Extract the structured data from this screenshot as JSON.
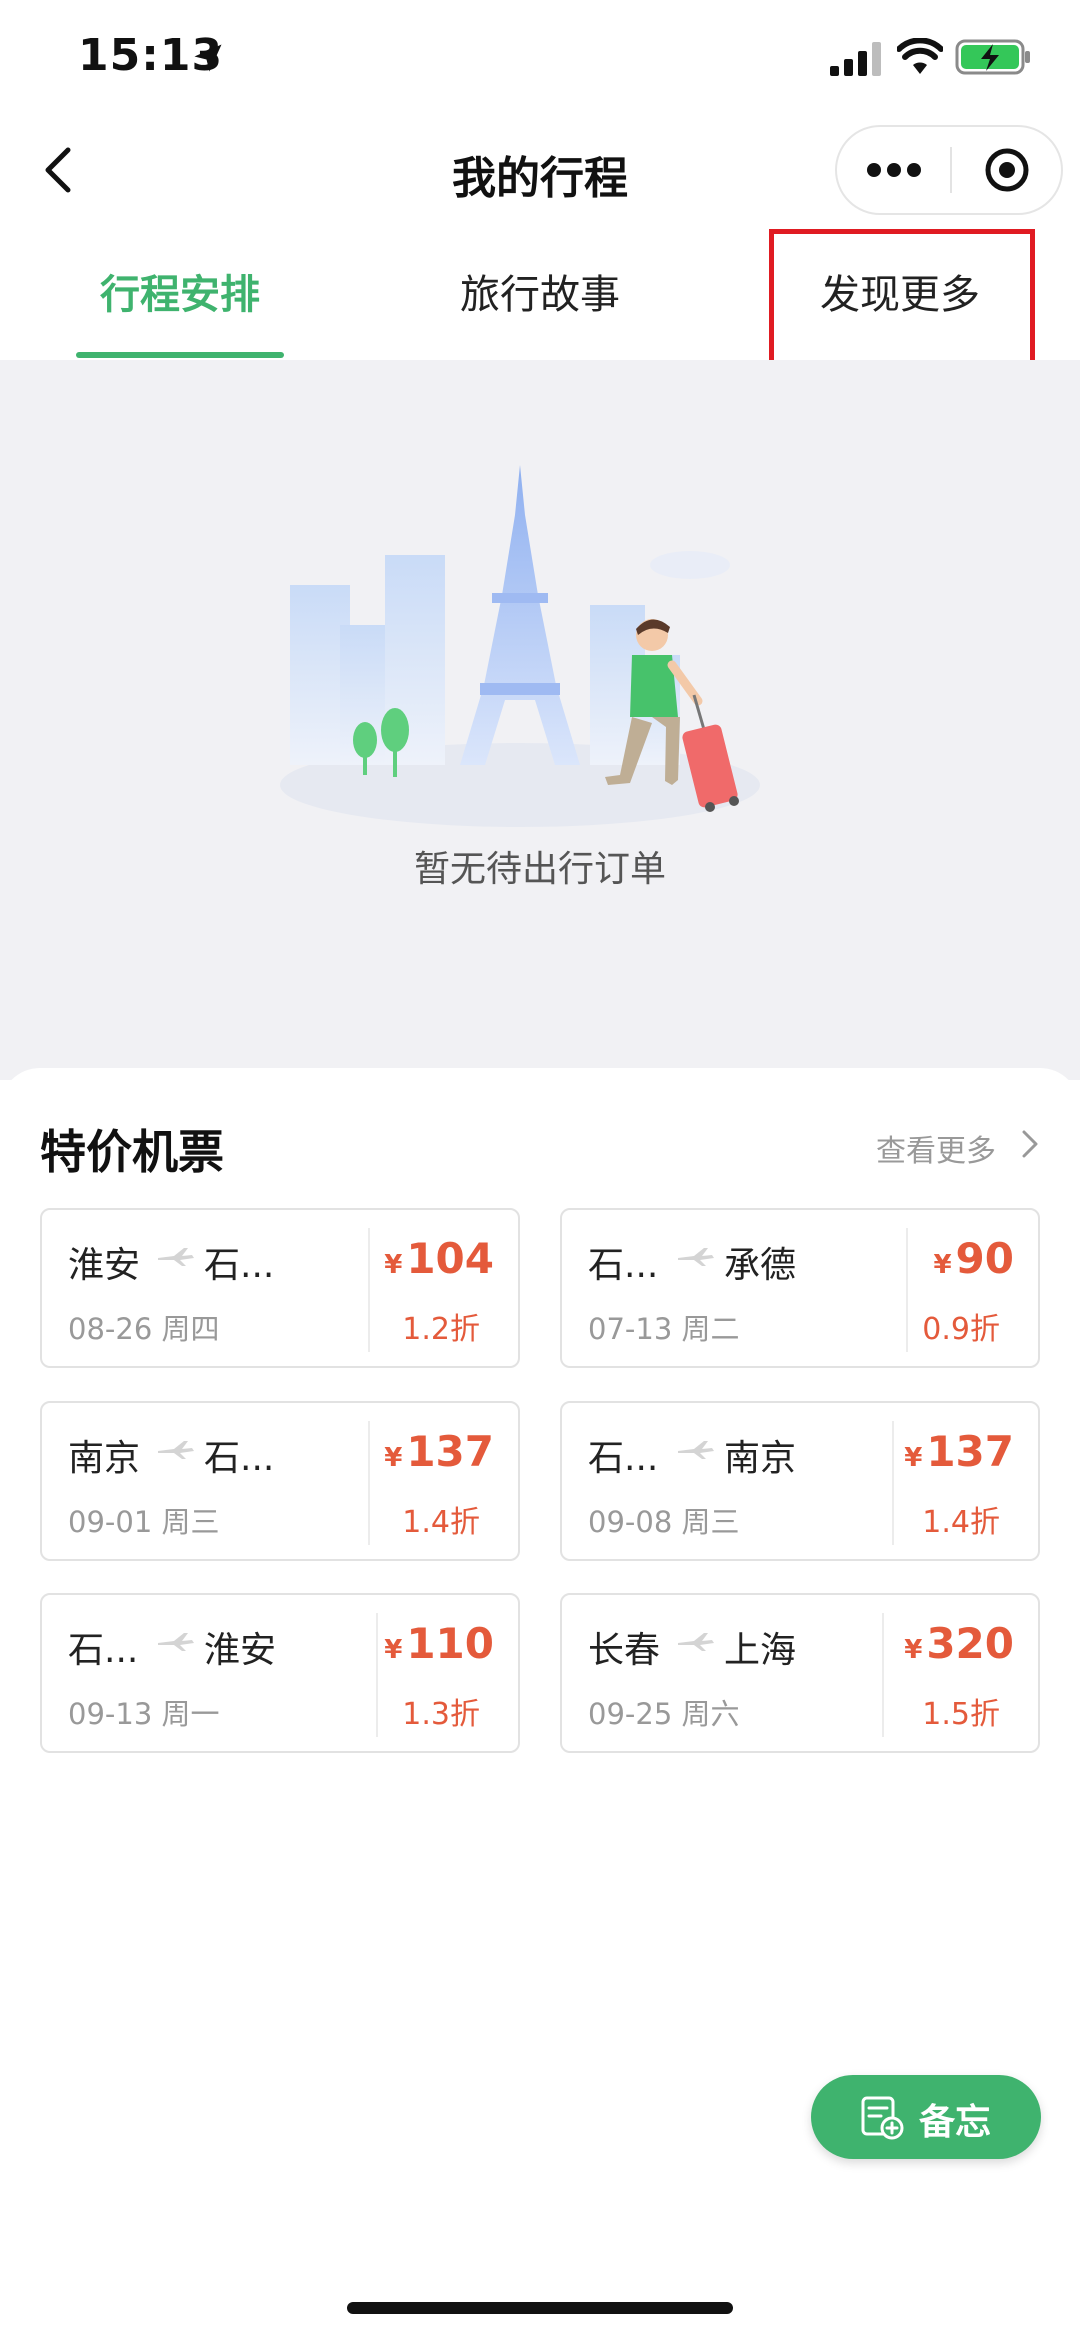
{
  "status_bar": {
    "time": "15:13"
  },
  "nav": {
    "title": "我的行程"
  },
  "tabs": [
    {
      "label": "行程安排",
      "active": true
    },
    {
      "label": "旅行故事",
      "active": false
    },
    {
      "label": "发现更多",
      "active": false,
      "highlighted": true
    }
  ],
  "empty_state": {
    "message": "暂无待出行订单"
  },
  "deals": {
    "title": "特价机票",
    "see_more": "查看更多",
    "currency": "¥",
    "cards": [
      {
        "from": "淮安",
        "to": "石...",
        "date": "08-26 周四",
        "price": "104",
        "discount": "1.2折"
      },
      {
        "from": "石...",
        "to": "承德",
        "date": "07-13 周二",
        "price": "90",
        "discount": "0.9折"
      },
      {
        "from": "南京",
        "to": "石...",
        "date": "09-01 周三",
        "price": "137",
        "discount": "1.4折"
      },
      {
        "from": "石...",
        "to": "南京",
        "date": "09-08 周三",
        "price": "137",
        "discount": "1.4折"
      },
      {
        "from": "石...",
        "to": "淮安",
        "date": "09-13 周一",
        "price": "110",
        "discount": "1.3折"
      },
      {
        "from": "长春",
        "to": "上海",
        "date": "09-25 周六",
        "price": "320",
        "discount": "1.5折"
      }
    ]
  },
  "fab": {
    "label": "备忘"
  },
  "colors": {
    "accent": "#3fb36e",
    "price": "#e45a3b",
    "highlight": "#e01b22"
  }
}
